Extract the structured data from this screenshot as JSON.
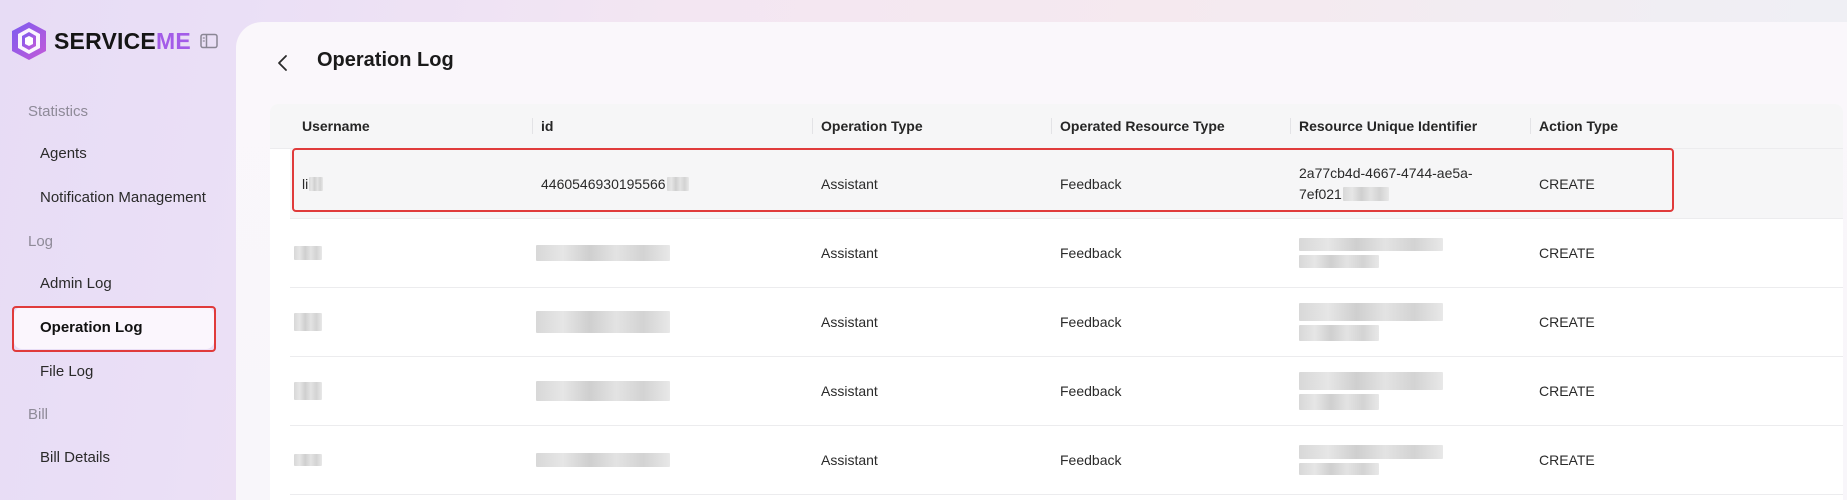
{
  "brand": {
    "name_prefix": "SERVICE",
    "name_suffix": "ME",
    "accent_color": "#a35ce8"
  },
  "sidebar": {
    "sections": [
      {
        "title": "Statistics",
        "items": [
          "Agents",
          "Notification Management"
        ]
      },
      {
        "title": "Log",
        "items": [
          "Admin Log",
          "Operation Log",
          "File Log"
        ]
      },
      {
        "title": "Bill",
        "items": [
          "Bill Details"
        ]
      }
    ],
    "active_item": "Operation Log",
    "collapse_icon": "sidebar-collapse-icon"
  },
  "page": {
    "title": "Operation Log",
    "back_icon": "chevron-left-icon"
  },
  "table": {
    "columns": [
      "Username",
      "id",
      "Operation Type",
      "Operated Resource Type",
      "Resource Unique Identifier",
      "Action Type"
    ],
    "rows": [
      {
        "username": "li",
        "id": "4460546930195566",
        "operation_type": "Assistant",
        "resource_type": "Feedback",
        "resource_id": "2a77cb4d-4667-4744-ae5a-\n7ef021",
        "action_type": "CREATE",
        "redacted": false
      },
      {
        "username": "",
        "id": "",
        "operation_type": "Assistant",
        "resource_type": "Feedback",
        "resource_id": "",
        "action_type": "CREATE",
        "redacted": true
      },
      {
        "username": "",
        "id": "",
        "operation_type": "Assistant",
        "resource_type": "Feedback",
        "resource_id": "",
        "action_type": "CREATE",
        "redacted": true
      },
      {
        "username": "",
        "id": "",
        "operation_type": "Assistant",
        "resource_type": "Feedback",
        "resource_id": "",
        "action_type": "CREATE",
        "redacted": true
      },
      {
        "username": "",
        "id": "",
        "operation_type": "Assistant",
        "resource_type": "Feedback",
        "resource_id": "",
        "action_type": "CREATE",
        "redacted": true
      }
    ]
  },
  "colors": {
    "highlight_border": "#e03b3b"
  }
}
